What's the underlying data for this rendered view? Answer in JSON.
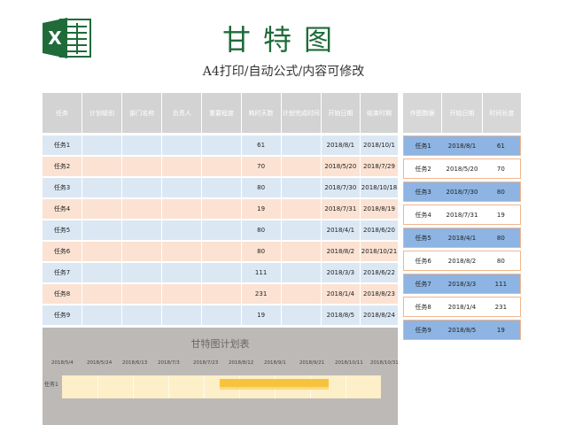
{
  "header": {
    "title": "甘特图",
    "subtitle": "A4打印/自动公式/内容可修改",
    "logo_icon": "excel-logo-icon",
    "logo_letter": "X",
    "accent_color": "#1f6b3a"
  },
  "main_table": {
    "columns": [
      "任务",
      "计划级别",
      "部门名称",
      "负责人",
      "重要程度",
      "耗时天数",
      "计划完成时间",
      "开始日期",
      "结束时期"
    ],
    "rows": [
      {
        "task": "任务1",
        "days": "61",
        "start": "2018/8/1",
        "end": "2018/10/1"
      },
      {
        "task": "任务2",
        "days": "70",
        "start": "2018/5/20",
        "end": "2018/7/29"
      },
      {
        "task": "任务3",
        "days": "80",
        "start": "2018/7/30",
        "end": "2018/10/18"
      },
      {
        "task": "任务4",
        "days": "19",
        "start": "2018/7/31",
        "end": "2018/8/19"
      },
      {
        "task": "任务5",
        "days": "80",
        "start": "2018/4/1",
        "end": "2018/6/20"
      },
      {
        "task": "任务6",
        "days": "80",
        "start": "2018/8/2",
        "end": "2018/10/21"
      },
      {
        "task": "任务7",
        "days": "111",
        "start": "2018/3/3",
        "end": "2018/6/22"
      },
      {
        "task": "任务8",
        "days": "231",
        "start": "2018/1/4",
        "end": "2018/8/23"
      },
      {
        "task": "任务9",
        "days": "19",
        "start": "2018/8/5",
        "end": "2018/8/24"
      }
    ]
  },
  "side_table": {
    "columns": [
      "作图数据",
      "开始日期",
      "时间长度"
    ],
    "rows": [
      {
        "task": "任务1",
        "start": "2018/8/1",
        "length": "61"
      },
      {
        "task": "任务2",
        "start": "2018/5/20",
        "length": "70"
      },
      {
        "task": "任务3",
        "start": "2018/7/30",
        "length": "80"
      },
      {
        "task": "任务4",
        "start": "2018/7/31",
        "length": "19"
      },
      {
        "task": "任务5",
        "start": "2018/4/1",
        "length": "80"
      },
      {
        "task": "任务6",
        "start": "2018/8/2",
        "length": "80"
      },
      {
        "task": "任务7",
        "start": "2018/3/3",
        "length": "111"
      },
      {
        "task": "任务8",
        "start": "2018/1/4",
        "length": "231"
      },
      {
        "task": "任务9",
        "start": "2018/8/5",
        "length": "19"
      }
    ]
  },
  "gantt": {
    "title": "甘特图计划表",
    "dates": [
      "2018/5/4",
      "2018/5/24",
      "2018/6/13",
      "2018/7/3",
      "2018/7/23",
      "2018/8/12",
      "2018/9/1",
      "2018/9/21",
      "2018/10/11",
      "2018/10/31"
    ],
    "first_task_label": "任务1"
  },
  "colors": {
    "header_gray": "#d3d3d3",
    "row_blue": "#dbe8f4",
    "row_peach": "#fbe2d2",
    "side_blue": "#8db4e2",
    "gantt_bg": "#bdb9b7",
    "gantt_track": "#fdefc7",
    "gantt_bar": "#f6c33f"
  }
}
